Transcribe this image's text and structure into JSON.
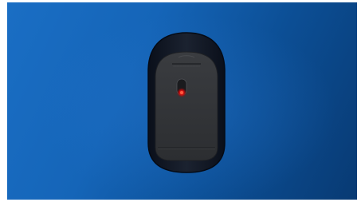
{
  "scene": {
    "subject": "mouse-underside-icon",
    "background_color": "#1565b8",
    "sensor_color": "#e01010"
  }
}
